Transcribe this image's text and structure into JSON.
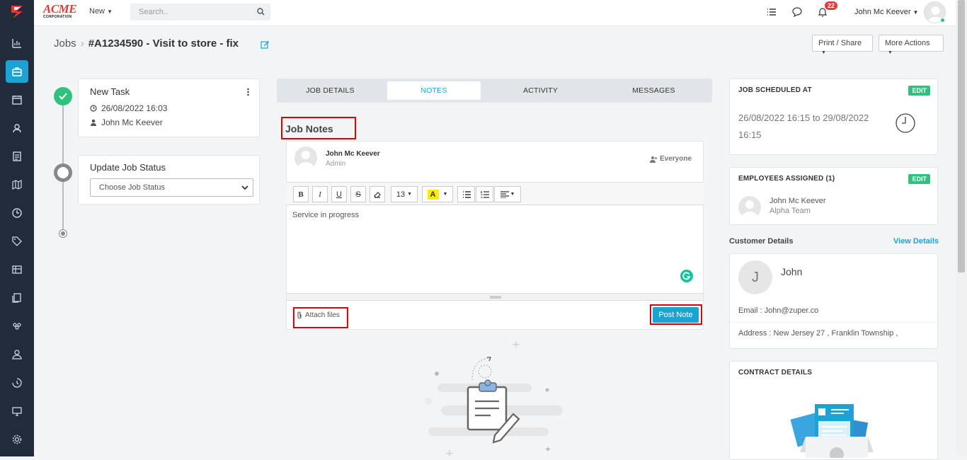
{
  "topbar": {
    "brand": "ACME",
    "brand_sub": "CORPORATION",
    "new_label": "New",
    "search_placeholder": "Search..",
    "notification_count": "22",
    "user_name": "John Mc Keever"
  },
  "sidebar": {
    "items": [
      "reports-icon",
      "jobs-icon",
      "calendar-icon",
      "customers-icon",
      "invoices-icon",
      "map-icon",
      "timesheet-icon",
      "tags-icon",
      "assets-icon",
      "quotes-icon",
      "team-icon",
      "users-icon",
      "history-icon",
      "monitor-icon",
      "settings-icon"
    ],
    "active": "jobs-icon"
  },
  "breadcrumb": {
    "root": "Jobs",
    "separator": "›",
    "current": "#A1234590 - Visit to store - fix"
  },
  "header_actions": {
    "print_share": "Print / Share",
    "more_actions": "More Actions"
  },
  "timeline": {
    "task": {
      "title": "New Task",
      "datetime": "26/08/2022 16:03",
      "user": "John Mc Keever"
    },
    "status": {
      "title": "Update Job Status",
      "select_value": "Choose Job Status"
    }
  },
  "tabs": [
    "JOB DETAILS",
    "NOTES",
    "ACTIVITY",
    "MESSAGES"
  ],
  "active_tab": "NOTES",
  "notes": {
    "heading": "Job Notes",
    "author": "John Mc Keever",
    "role": "Admin",
    "visibility": "Everyone",
    "font_size": "13",
    "text": "Service in progress",
    "attach_label": "Attach files",
    "post_label": "Post Note"
  },
  "schedule": {
    "title": "JOB SCHEDULED AT",
    "edit": "EDIT",
    "range_line1": "26/08/2022 16:15 to 29/08/2022",
    "range_line2": "16:15"
  },
  "employees": {
    "title": "EMPLOYEES ASSIGNED (1)",
    "edit": "EDIT",
    "name": "John Mc Keever",
    "team": "Alpha Team"
  },
  "customer": {
    "section_title": "Customer Details",
    "view_link": "View Details",
    "initial": "J",
    "name": "John",
    "email": "Email : John@zuper.co",
    "address": "Address : New Jersey 27 , Franklin Township ,"
  },
  "contract": {
    "title": "CONTRACT DETAILS"
  },
  "colors": {
    "accent": "#1ba3d6",
    "success": "#2ec27e",
    "sidebar": "#212b3b",
    "highlight": "#dd0000"
  }
}
